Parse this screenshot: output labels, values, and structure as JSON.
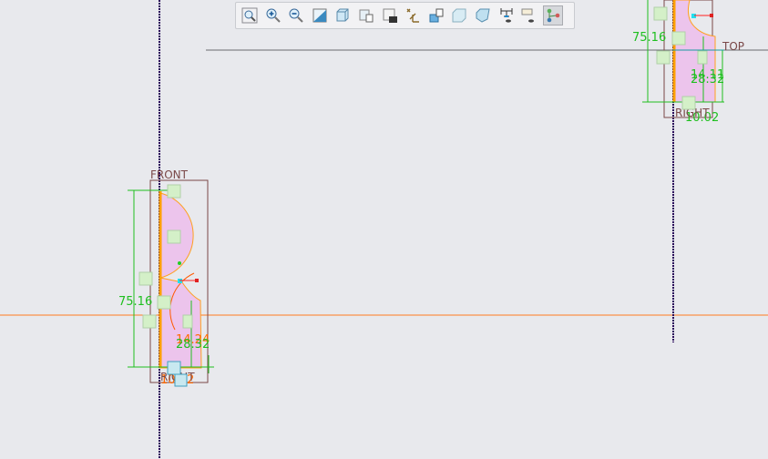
{
  "toolbar": {
    "items": [
      {
        "icon": "refit-icon",
        "active": false
      },
      {
        "icon": "zoom-in-icon",
        "active": false
      },
      {
        "icon": "zoom-out-icon",
        "active": false
      },
      {
        "icon": "repaint-icon",
        "active": false
      },
      {
        "icon": "display-style-icon",
        "active": false
      },
      {
        "icon": "saved-orientations-icon",
        "active": false
      },
      {
        "icon": "view-manager-icon",
        "active": false
      },
      {
        "icon": "datum-display-icon",
        "active": false
      },
      {
        "icon": "annotation-display-icon",
        "active": false
      },
      {
        "icon": "shaded-view-icon",
        "active": false
      },
      {
        "icon": "hidden-line-icon",
        "active": false
      },
      {
        "icon": "sketcher-display-icon",
        "active": false
      },
      {
        "icon": "constraint-display-icon",
        "active": false
      },
      {
        "icon": "vertex-display-icon",
        "active": true
      }
    ]
  },
  "colors": {
    "background": "#e8e9ed",
    "sketch_fill": "#ecc4ec",
    "dimension": "#1fbf1f",
    "highlight": "#ff6a00",
    "axis": "#2a0a5a",
    "datum_plane": "#7a4848"
  },
  "left_sketch": {
    "plane_top": "FRONT",
    "plane_bottom": "RIGHT",
    "dim_height": "75.16",
    "dim_a": "14.24",
    "dim_b": "28.32",
    "dim_c": "10.02"
  },
  "right_sketch": {
    "plane_side": "TOP",
    "plane_bottom": "RIGHT",
    "dim_height": "75.16",
    "dim_a": "14.11",
    "dim_b": "28.32",
    "dim_c": "10.02"
  }
}
